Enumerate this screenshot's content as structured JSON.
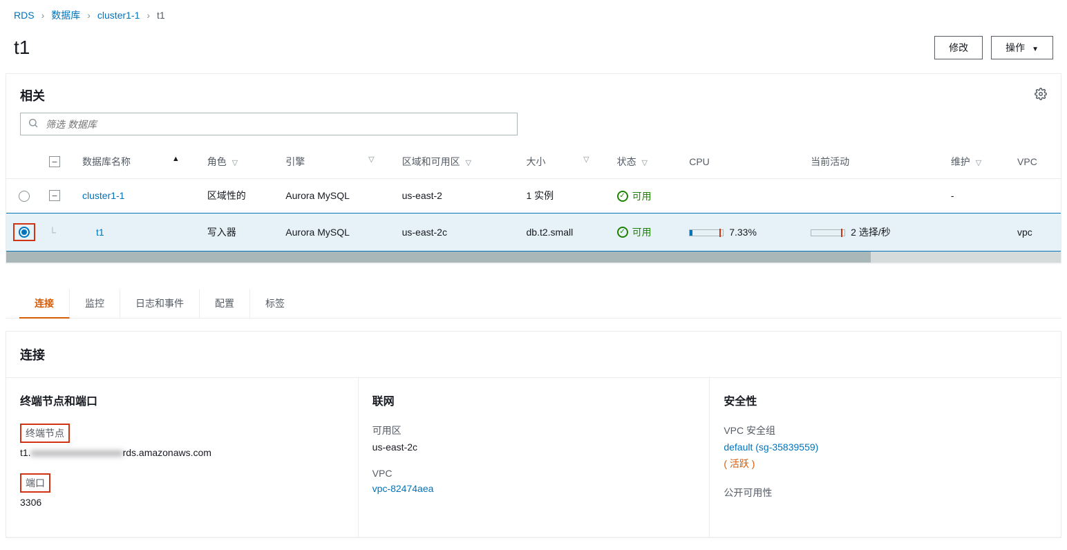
{
  "breadcrumb": {
    "root": "RDS",
    "db": "数据库",
    "cluster": "cluster1-1",
    "current": "t1"
  },
  "header": {
    "title": "t1",
    "modify_label": "修改",
    "actions_label": "操作"
  },
  "related_panel": {
    "title": "相关",
    "filter_placeholder": "筛选 数据库",
    "columns": {
      "name": "数据库名称",
      "role": "角色",
      "engine": "引擎",
      "region": "区域和可用区",
      "size": "大小",
      "status": "状态",
      "cpu": "CPU",
      "activity": "当前活动",
      "maintenance": "维护",
      "vpc": "VPC"
    },
    "rows": [
      {
        "name": "cluster1-1",
        "role": "区域性的",
        "engine": "Aurora MySQL",
        "region": "us-east-2",
        "size": "1 实例",
        "status": "可用",
        "cpu": "",
        "activity": "",
        "maintenance": "-"
      },
      {
        "name": "t1",
        "role": "写入器",
        "engine": "Aurora MySQL",
        "region": "us-east-2c",
        "size": "db.t2.small",
        "status": "可用",
        "cpu": "7.33%",
        "activity": "2 选择/秒",
        "maintenance": "",
        "vpc": "vpc"
      }
    ]
  },
  "tabs": {
    "connect": "连接",
    "monitor": "监控",
    "logs": "日志和事件",
    "config": "配置",
    "tags": "标签"
  },
  "connection": {
    "title": "连接",
    "endpoint_section_title": "终端节点和端口",
    "endpoint_label": "终端节点",
    "endpoint_prefix": "t1.",
    "endpoint_suffix": "rds.amazonaws.com",
    "port_label": "端口",
    "port_value": "3306",
    "network_section_title": "联网",
    "az_label": "可用区",
    "az_value": "us-east-2c",
    "vpc_label": "VPC",
    "vpc_value": "vpc-82474aea",
    "security_section_title": "安全性",
    "sg_label": "VPC 安全组",
    "sg_link": "default (sg-35839559)",
    "sg_status": "( 活跃 )",
    "public_label": "公开可用性"
  }
}
